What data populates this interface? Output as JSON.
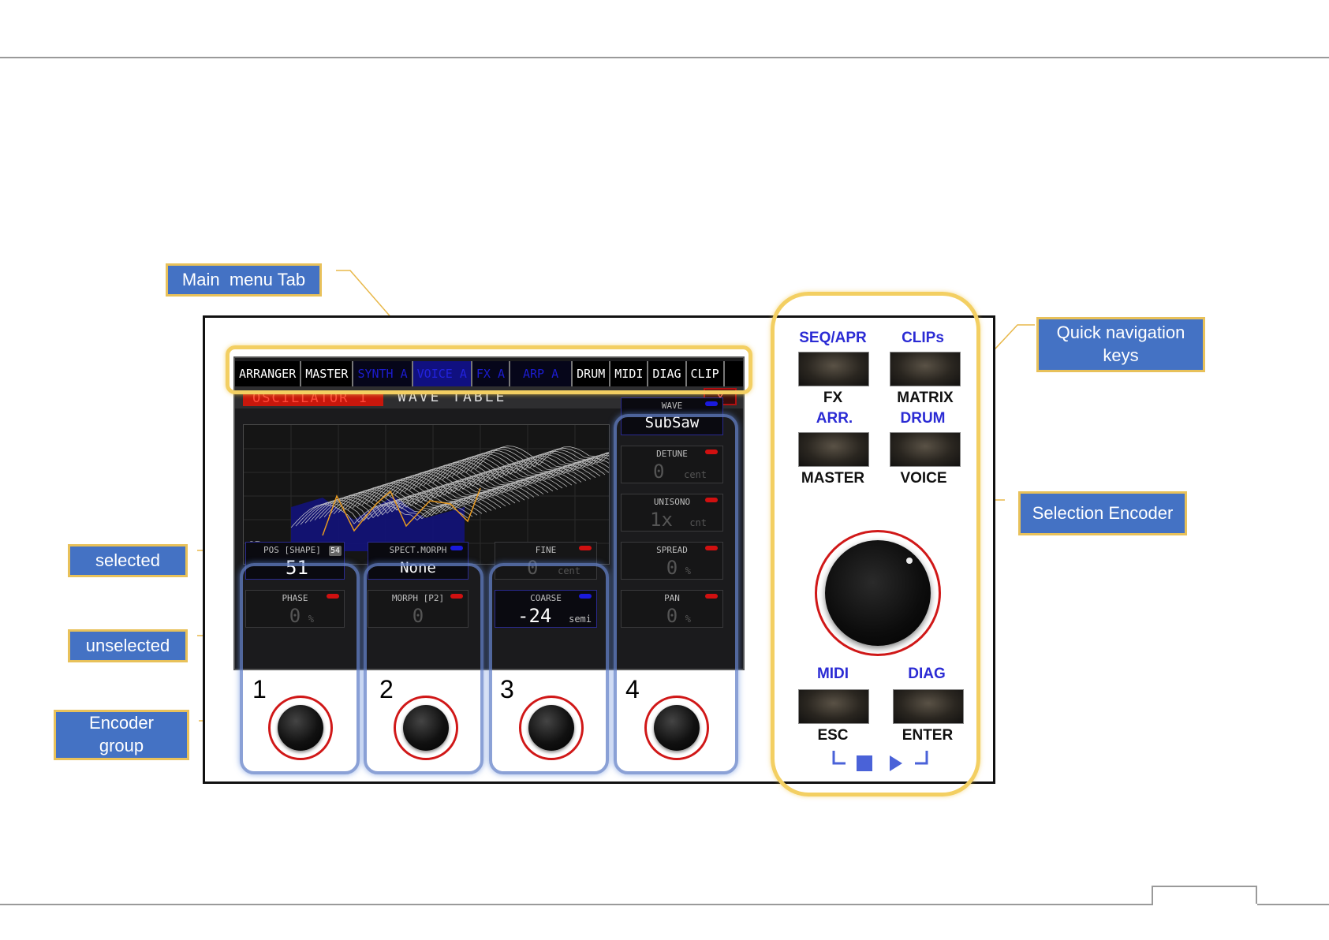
{
  "callouts": {
    "main_menu_tab": "Main  menu Tab",
    "quick_nav_line1": "Quick navigation",
    "quick_nav_line2": "keys",
    "selection_encoder": "Selection Encoder",
    "selected": "selected",
    "unselected": "unselected",
    "encoder_group_line1": "Encoder",
    "encoder_group_line2": "group"
  },
  "screen": {
    "tabs": [
      {
        "label": "ARRANGER",
        "active": false
      },
      {
        "label": "MASTER",
        "active": false
      },
      {
        "label": "SYNTH A",
        "active": true
      },
      {
        "label": "VOICE A",
        "active": true
      },
      {
        "label": "FX A",
        "active": true
      },
      {
        "label": "ARP A",
        "active": true
      },
      {
        "label": "DRUM",
        "active": false
      },
      {
        "label": "MIDI",
        "active": false
      },
      {
        "label": "DIAG",
        "active": false
      },
      {
        "label": "CLIP",
        "active": false
      }
    ],
    "oscillator_label": "OSCILLATOR 1",
    "mode_title": "WAVE TABLE",
    "close_label": "X",
    "view_mode": "3D",
    "params": {
      "wave": {
        "label": "WAVE",
        "value": "SubSaw",
        "unit": "",
        "led": "blue"
      },
      "detune": {
        "label": "DETUNE",
        "value": "0",
        "unit": "cent",
        "led": "red"
      },
      "unisono": {
        "label": "UNISONO",
        "value": "1x",
        "unit": "cnt",
        "led": "red"
      },
      "spread": {
        "label": "SPREAD",
        "value": "0",
        "unit": "%",
        "led": "red"
      },
      "pan": {
        "label": "PAN",
        "value": "0",
        "unit": "%",
        "led": "red"
      },
      "pos": {
        "label": "POS [SHAPE]",
        "value": "51",
        "badge": "54"
      },
      "phase": {
        "label": "PHASE",
        "value": "0",
        "unit": "%",
        "led": "red"
      },
      "spect_morph": {
        "label": "SPECT.MORPH",
        "value": "None",
        "led": "blue"
      },
      "morph": {
        "label": "MORPH [P2]",
        "value": "0",
        "led": "red"
      },
      "fine": {
        "label": "FINE",
        "value": "0",
        "unit": "cent",
        "led": "red"
      },
      "coarse": {
        "label": "COARSE",
        "value": "-24",
        "unit": "semi",
        "led": "blue"
      }
    }
  },
  "encoders": [
    "1",
    "2",
    "3",
    "4"
  ],
  "nav_keys": {
    "row1": [
      {
        "top": "SEQ/APR",
        "bottom": "FX"
      },
      {
        "top": "CLIPs",
        "bottom": "MATRIX"
      }
    ],
    "row2": [
      {
        "top": "ARR.",
        "bottom": "MASTER"
      },
      {
        "top": "DRUM",
        "bottom": "VOICE"
      }
    ],
    "row3": [
      {
        "top": "MIDI",
        "bottom": "ESC"
      },
      {
        "top": "DIAG",
        "bottom": "ENTER"
      }
    ]
  },
  "colors": {
    "callout_bg": "#4472c4",
    "callout_border": "#e8c15a",
    "accent_blue": "#2b2bd4",
    "led_red": "#d01010",
    "led_blue": "#1a1add",
    "highlight_yellow": "#f3cf62"
  },
  "icons": [
    "stop-icon",
    "play-icon",
    "bracket-left-icon",
    "bracket-right-icon",
    "knob-icon"
  ]
}
